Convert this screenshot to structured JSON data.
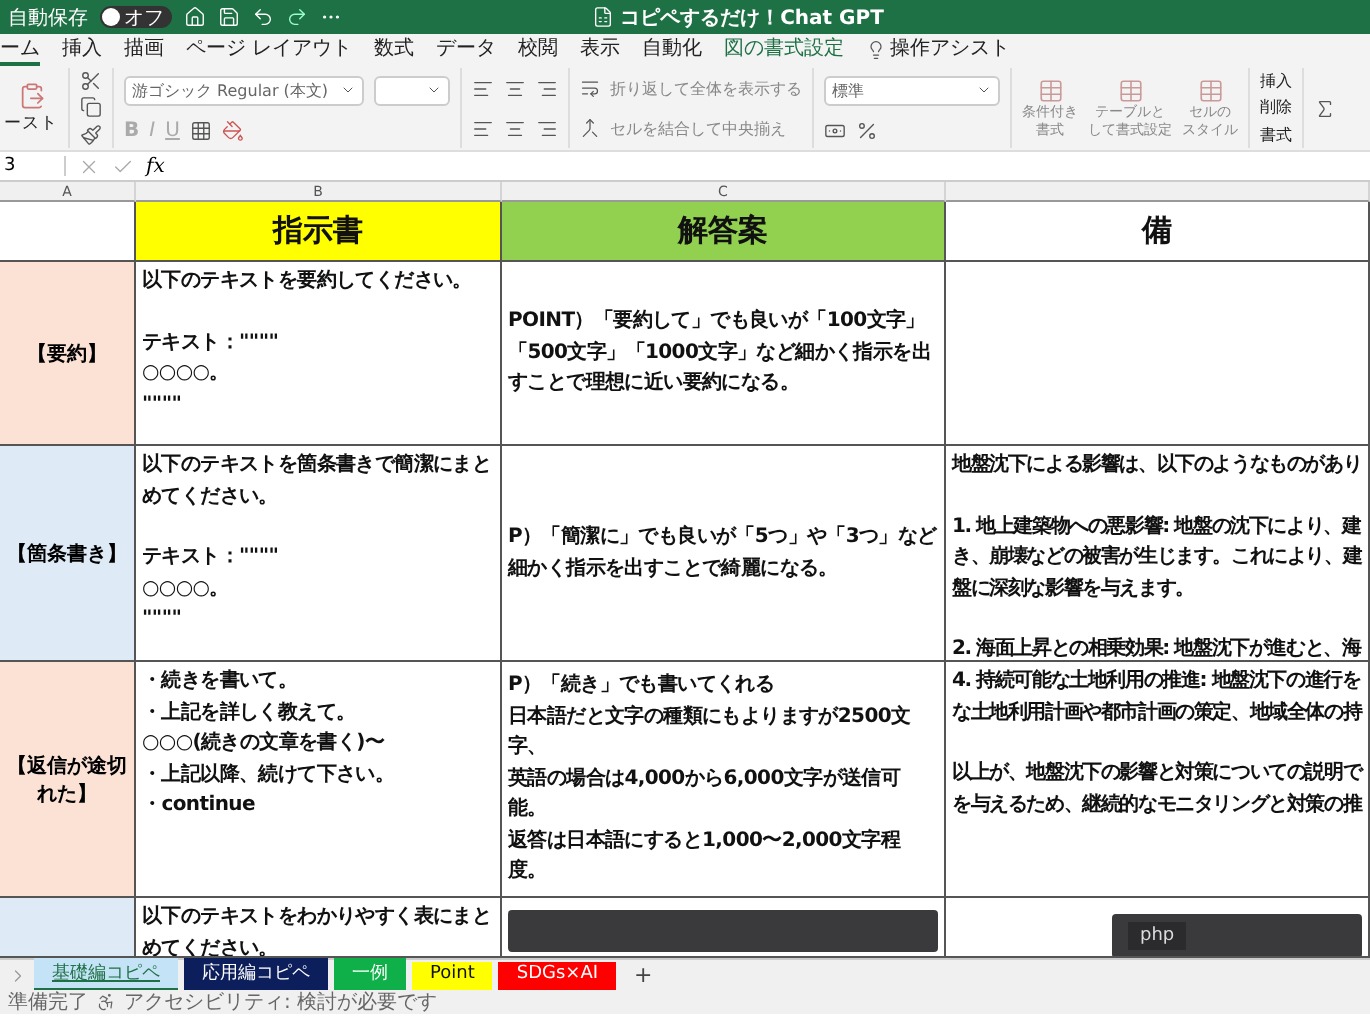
{
  "titlebar": {
    "autosave_label": "自動保存",
    "autosave_state": "オフ",
    "autosave_on": false,
    "title": "コピペするだけ！Chat GPT"
  },
  "ribbon_tabs": [
    {
      "label": "ーム",
      "kind": "tab",
      "selected": true
    },
    {
      "label": "挿入",
      "kind": "tab",
      "selected": false
    },
    {
      "label": "描画",
      "kind": "tab",
      "selected": false
    },
    {
      "label": "ページ レイアウト",
      "kind": "tab",
      "selected": false
    },
    {
      "label": "数式",
      "kind": "tab",
      "selected": false
    },
    {
      "label": "データ",
      "kind": "tab",
      "selected": false
    },
    {
      "label": "校閲",
      "kind": "tab",
      "selected": false
    },
    {
      "label": "表示",
      "kind": "tab",
      "selected": false
    },
    {
      "label": "自動化",
      "kind": "tab",
      "selected": false
    },
    {
      "label": "図の書式設定",
      "kind": "contextual",
      "selected": false
    },
    {
      "label": "操作アシスト",
      "kind": "assist",
      "selected": false
    }
  ],
  "ribbon": {
    "paste_label": "ースト",
    "font_name": "游ゴシック Regular (本文)",
    "format_buttons": [
      "B",
      "I",
      "U"
    ],
    "wrap_label": "折り返して全体を表示する",
    "merge_label": "セルを結合して中央揃え",
    "number_format": "標準",
    "style_buttons": [
      [
        "条件付き",
        "書式"
      ],
      [
        "テーブルと",
        "して書式設定"
      ],
      [
        "セルの",
        "スタイル"
      ]
    ],
    "cell_buttons": [
      "挿入",
      "削除",
      "書式"
    ]
  },
  "formula_bar": {
    "name_box": "3",
    "fx": "fx"
  },
  "columns": [
    "A",
    "B",
    "C"
  ],
  "sheet": {
    "headers": [
      {
        "text": "指示書",
        "color": "#ffff00"
      },
      {
        "text": "解答案",
        "color": "#92d050"
      },
      {
        "text": "備",
        "color": "#ffffff"
      }
    ],
    "rows": [
      {
        "label": "【要約】",
        "color": "#fbe2d5",
        "instruction": {
          "kind": "text",
          "paragraphs": [
            [
              "以下のテキストを要約してください。"
            ],
            [
              "テキスト：\"\"\"\"",
              "○○○○。",
              "\"\"\"\""
            ]
          ]
        },
        "answer": {
          "kind": "text",
          "paragraphs": [
            [
              "POINT）「要約して」でも良いが「100文字」「500文字」「1000文字」など細かく指示を出すことで理想に近い要約になる。"
            ]
          ]
        },
        "example": {
          "kind": "none"
        }
      },
      {
        "label": "【箇条書き】",
        "color": "#deebf7",
        "instruction": {
          "kind": "text",
          "paragraphs": [
            [
              "以下のテキストを箇条書きで簡潔にまとめてください。"
            ],
            [
              "テキスト：\"\"\"\"",
              "○○○○。",
              "\"\"\"\""
            ]
          ]
        },
        "answer": {
          "kind": "text",
          "paragraphs": [
            [
              "P）「簡潔に」でも良いが「5つ」や「3つ」など細かく指示を出すことで綺麗になる。"
            ]
          ]
        },
        "example": {
          "kind": "lines",
          "paragraphs": [
            [
              "地盤沈下による影響は、以下のようなものがあり"
            ],
            [
              "1. 地上建築物への悪影響: 地盤の沈下により、建",
              "き、崩壊などの被害が生じます。これにより、建",
              "盤に深刻な影響を与えます。"
            ],
            [
              "2. 海面上昇との相乗効果: 地盤沈下が進むと、海"
            ]
          ]
        }
      },
      {
        "label": "【返信が途切れた】",
        "color": "#fbe2d5",
        "instruction": {
          "kind": "text",
          "paragraphs": [
            [
              "・続きを書いて。",
              "・上記を詳しく教えて。",
              "○○○(続きの文章を書く)〜",
              "・上記以降、続けて下さい。",
              "・continue"
            ]
          ]
        },
        "answer": {
          "kind": "text",
          "paragraphs": [
            [
              "P）「続き」でも書いてくれる",
              "日本語だと文字の種類にもよりますが2500文字、",
              "英語の場合は4,000から6,000文字が送信可能。",
              "返答は日本語にすると1,000〜2,000文字程度。"
            ]
          ]
        },
        "example": {
          "kind": "lines",
          "paragraphs": [
            [
              "4. 持続可能な土地利用の推進: 地盤沈下の進行を",
              "な土地利用計画や都市計画の策定、地域全体の持"
            ],
            [
              "以上が、地盤沈下の影響と対策についての説明で",
              "を与えるため、継続的なモニタリングと対策の推"
            ]
          ]
        }
      },
      {
        "color": "#deebf7",
        "instruction": {
          "kind": "text",
          "paragraphs": [
            [
              "以下のテキストをわかりやすく表にまとめてください。"
            ]
          ]
        },
        "answer": {
          "kind": "image"
        },
        "example": {
          "kind": "image",
          "caption": "php"
        }
      }
    ]
  },
  "sheet_tabs": [
    {
      "label": "基礎編コピペ",
      "color": "#c5e3f6",
      "selected": true
    },
    {
      "label": "応用編コピペ",
      "color": "#0c1f5c",
      "selected": false
    },
    {
      "label": "一例",
      "color": "#0fb04a",
      "selected": false
    },
    {
      "label": "Point",
      "color": "#ffff00",
      "selected": false
    },
    {
      "label": "SDGs×AI",
      "color": "#ff0000",
      "selected": false
    }
  ],
  "add_sheet": "+",
  "status_bar": {
    "ready": "準備完了",
    "accessibility": "アクセシビリティ: 検討が必要です"
  }
}
